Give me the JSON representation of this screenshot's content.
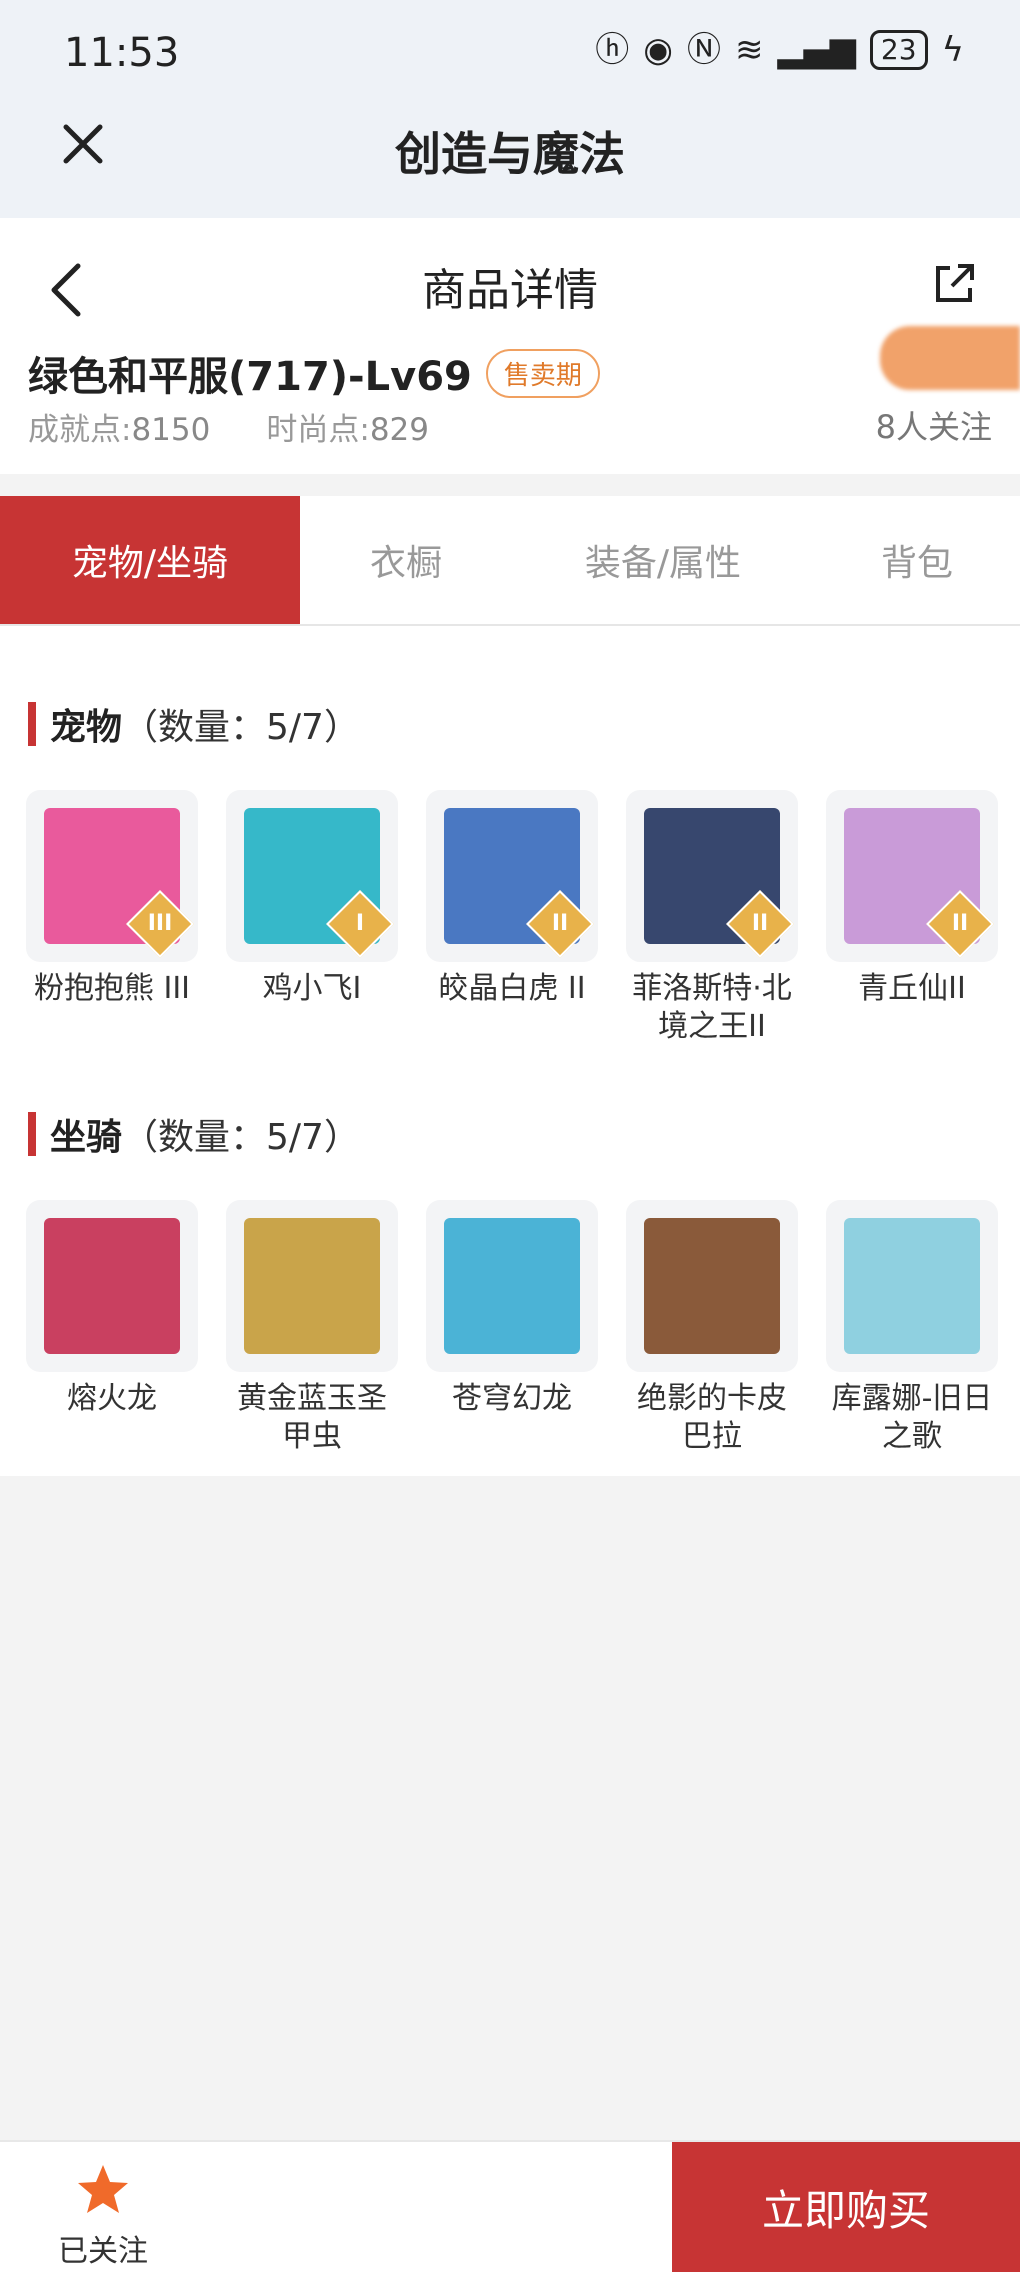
{
  "status_bar": {
    "time": "11:53",
    "battery": "23",
    "icons": [
      "hd-icon",
      "eye-icon",
      "nfc-icon",
      "wifi-icon",
      "signal-icon",
      "battery-icon",
      "charging-icon"
    ]
  },
  "app_header": {
    "title": "创造与魔法"
  },
  "detail_header": {
    "title": "商品详情",
    "item_name": "绿色和平服(717)-Lv69",
    "sale_badge": "售卖期",
    "achievement_label": "成就点:",
    "achievement_value": "8150",
    "fashion_label": "时尚点:",
    "fashion_value": "829",
    "followers": "8人关注"
  },
  "tabs": [
    {
      "label": "宠物/坐骑",
      "active": true
    },
    {
      "label": "衣橱",
      "active": false
    },
    {
      "label": "装备/属性",
      "active": false
    },
    {
      "label": "背包",
      "active": false
    }
  ],
  "pets": {
    "title": "宠物",
    "count": "（数量：5/7）",
    "items": [
      {
        "name": "粉抱抱熊 III",
        "grade": "III",
        "color": "#e95a9c"
      },
      {
        "name": "鸡小飞I",
        "grade": "I",
        "color": "#36b8c9"
      },
      {
        "name": "皎晶白虎 II",
        "grade": "II",
        "color": "#4a78c2"
      },
      {
        "name": "菲洛斯特·北境之王II",
        "grade": "II",
        "color": "#37476e"
      },
      {
        "name": "青丘仙II",
        "grade": "II",
        "color": "#c99bd8"
      }
    ]
  },
  "mounts": {
    "title": "坐骑",
    "count": "（数量：5/7）",
    "items": [
      {
        "name": "熔火龙",
        "color": "#c94060"
      },
      {
        "name": "黄金蓝玉圣甲虫",
        "color": "#c9a44a"
      },
      {
        "name": "苍穹幻龙",
        "color": "#4bb3d6"
      },
      {
        "name": "绝影的卡皮巴拉",
        "color": "#8a5a3a"
      },
      {
        "name": "库露娜-旧日之歌",
        "color": "#8fd0e0"
      }
    ]
  },
  "bottom_bar": {
    "follow_label": "已关注",
    "buy_label": "立即购买"
  },
  "colors": {
    "accent": "#c73434",
    "badge": "#e07a2a",
    "star": "#f06a2a"
  }
}
